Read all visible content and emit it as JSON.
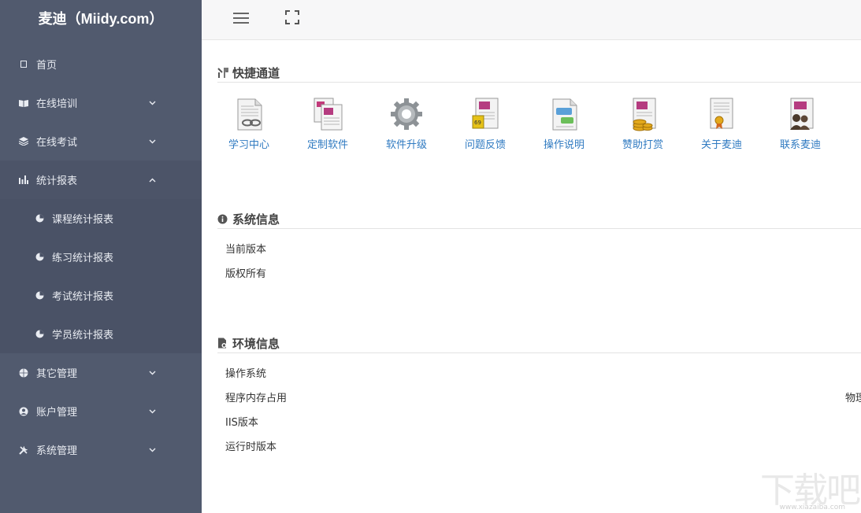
{
  "sidebar": {
    "brand": "麦迪（Miidy.com）",
    "items": [
      {
        "label": "首页"
      },
      {
        "label": "在线培训"
      },
      {
        "label": "在线考试"
      },
      {
        "label": "统计报表"
      },
      {
        "label": "其它管理"
      },
      {
        "label": "账户管理"
      },
      {
        "label": "系统管理"
      }
    ],
    "subitems": [
      {
        "label": "课程统计报表"
      },
      {
        "label": "练习统计报表"
      },
      {
        "label": "考试统计报表"
      },
      {
        "label": "学员统计报表"
      }
    ]
  },
  "quick": {
    "title": "快捷通道",
    "items": [
      {
        "label": "学习中心",
        "icon": "document-link-icon"
      },
      {
        "label": "定制软件",
        "icon": "documents-icon"
      },
      {
        "label": "软件升级",
        "icon": "gear-icon"
      },
      {
        "label": "问题反馈",
        "icon": "feedback-document-icon"
      },
      {
        "label": "操作说明",
        "icon": "chat-document-icon"
      },
      {
        "label": "赞助打赏",
        "icon": "coins-document-icon"
      },
      {
        "label": "关于麦迪",
        "icon": "certificate-icon"
      },
      {
        "label": "联系麦迪",
        "icon": "contacts-icon"
      }
    ]
  },
  "sysinfo": {
    "title": "系统信息",
    "rows": [
      "当前版本",
      "版权所有"
    ]
  },
  "envinfo": {
    "title": "环境信息",
    "rows": [
      "操作系统",
      "程序内存占用",
      "IIS版本",
      "运行时版本"
    ],
    "cutoff": "物理"
  },
  "watermark": {
    "text": "下载吧",
    "url": "www.xiazaiba.com"
  }
}
